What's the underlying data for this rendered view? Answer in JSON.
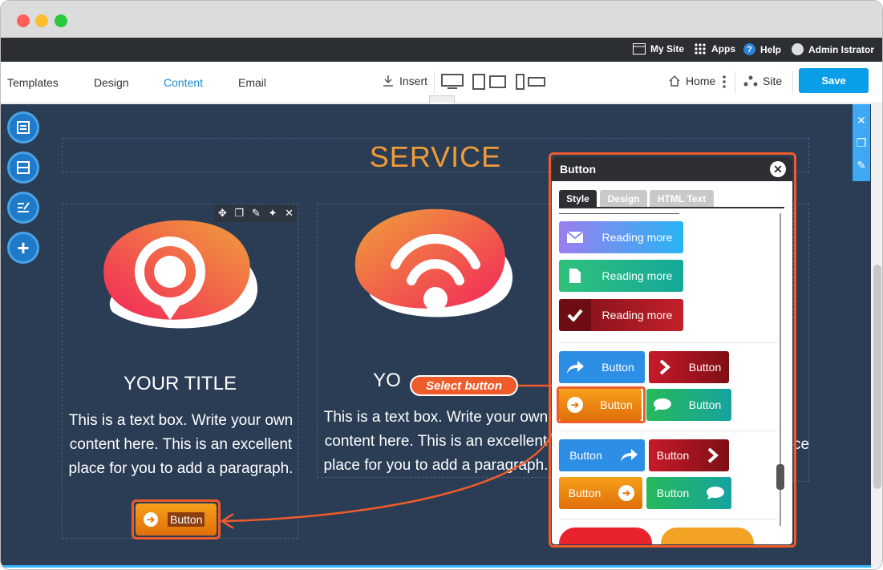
{
  "topbar": {
    "my_site": "My Site",
    "apps": "Apps",
    "help": "Help",
    "user": "Admin Istrator"
  },
  "toolbar": {
    "tabs": [
      {
        "label": "Templates"
      },
      {
        "label": "Design"
      },
      {
        "label": "Content",
        "active": true
      },
      {
        "label": "Email"
      }
    ],
    "insert": "Insert",
    "home": "Home",
    "site": "Site",
    "save": "Save"
  },
  "canvas": {
    "section_title": "SERVICE",
    "columns": [
      {
        "title": "YOUR TITLE",
        "text": "This is a text box. Write your own content here. This is an excellent place for you to add a paragraph.",
        "icon": "location-pin-icon"
      },
      {
        "title": "YO",
        "text": "This is a text box. Write your own content here. This is an excellent place for you to add a paragraph.",
        "icon": "wifi-icon"
      },
      {
        "partial_text": "ce"
      }
    ],
    "placed_button": "Button"
  },
  "callout": "Select button",
  "panel": {
    "title": "Button",
    "tabs": [
      "Style",
      "Design",
      "HTML Text"
    ],
    "group1": [
      "Reading more",
      "Reading more",
      "Reading more"
    ],
    "group2": [
      "Button",
      "Button",
      "Button",
      "Button"
    ],
    "group3": [
      "Button",
      "Button",
      "Button",
      "Button"
    ]
  },
  "colors": {
    "accent": "#ef5b2b",
    "save": "#0a9ee8",
    "canvas_bg": "#2a3d55",
    "service_title": "#f19b38"
  }
}
